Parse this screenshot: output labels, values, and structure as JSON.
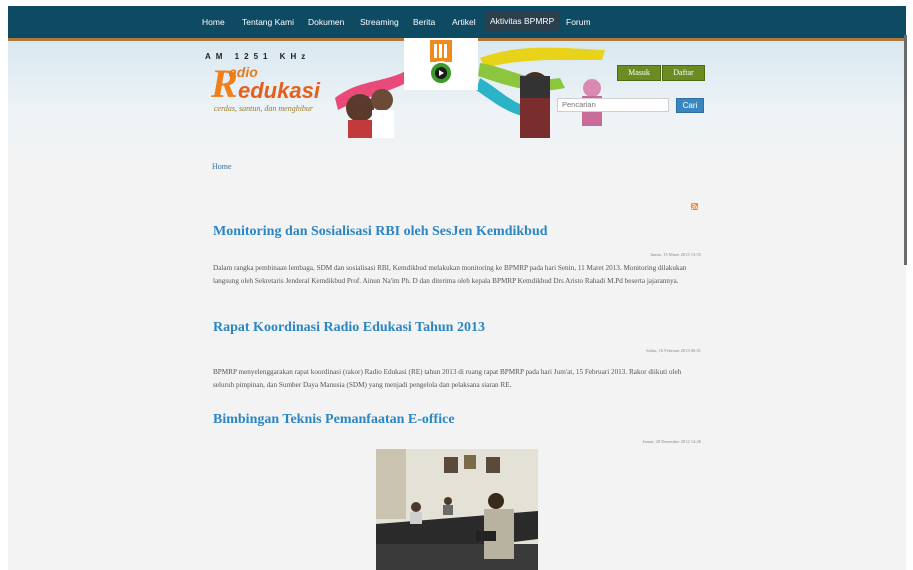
{
  "nav": {
    "items": [
      {
        "label": "Home"
      },
      {
        "label": "Tentang Kami"
      },
      {
        "label": "Dokumen"
      },
      {
        "label": "Streaming"
      },
      {
        "label": "Berita"
      },
      {
        "label": "Artikel"
      },
      {
        "label": "Aktivitas BPMRP"
      },
      {
        "label": "Forum"
      }
    ],
    "active": "Aktivitas BPMRP"
  },
  "logo": {
    "frequency": "AM 1251 KHz",
    "radio": "adio",
    "initial": "R",
    "name": "edukasi",
    "tagline": "cerdas, santun, dan menghibur"
  },
  "auth": {
    "login_label": "Masuk",
    "register_label": "Daftar"
  },
  "search": {
    "placeholder": "Pencarian",
    "button_label": "Cari"
  },
  "breadcrumb": {
    "home": "Home"
  },
  "posts": [
    {
      "title": "Monitoring dan Sosialisasi RBI oleh SesJen Kemdikbud",
      "date": "Jumat, 15 Maret 2013 13:55",
      "body": "Dalam rangka pembinaan lembaga, SDM dan sosialisasi RBI, Kemdikbud melakukan monitoring ke BPMRP pada hari Senin, 11 Maret 2013. Monitoring dilakukan langsung oleh Sekretaris Jenderal Kemdikbud Prof. Ainun Na'im Ph. D dan diterima oleh kepala BPMRP Kemdikbud Drs Aristo Rahadi M.Pd beserta jajarannya."
    },
    {
      "title": "Rapat Koordinasi Radio Edukasi Tahun 2013",
      "date": "Sabtu, 16 Februari 2013 00:01",
      "body": "BPMRP menyelenggarakan rapat koordinasi (rakor) Radio Edukasi (RE) tahun 2013 di ruang rapat BPMRP pada hari Jum'at, 15 Februari 2013. Rakor diikuti oleh seluruh pimpinan, dan Sumber Daya Manusia (SDM) yang menjadi pengelola dan pelaksana siaran RE."
    },
    {
      "title": "Bimbingan Teknis Pemanfaatan E-office",
      "date": "Jumat, 28 Desember 2012 14:26",
      "body": ""
    }
  ],
  "colors": {
    "topbar": "#0f4a63",
    "accent_link": "#2b86c4",
    "button_green": "#6a8c22",
    "button_blue": "#3a87c0"
  }
}
